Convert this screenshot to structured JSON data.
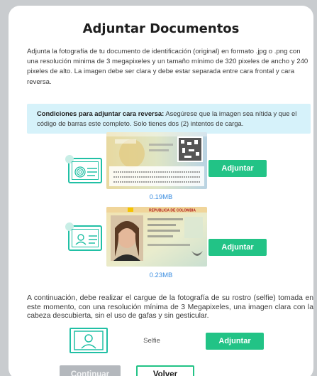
{
  "modal": {
    "title": "Adjuntar Documentos",
    "intro": "Adjunta la fotografía de tu documento de identificación (original) en formato .jpg o .png con una resolución minima de 3 megapixeles y un tamaño mínimo de 320 pixeles de ancho y 240 pixeles de alto. La imagen debe ser clara y debe estar separada entre cara frontal y cara reversa.",
    "notice": {
      "bold": "Condiciones para adjuntar cara reversa:",
      "text": " Asegúrese que la imagen sea nítida y que el código de barras este completo. Solo tienes dos (2) intentos de carga."
    },
    "documents": [
      {
        "id": "reverse",
        "size": "0.19MB",
        "button": "Adjuntar",
        "icon": "fingerprint-card-icon"
      },
      {
        "id": "front",
        "size": "0.23MB",
        "button": "Adjuntar",
        "icon": "id-card-icon",
        "header_text": "REPUBLICA DE COLOMBIA"
      }
    ],
    "selfie": {
      "instructions": "A continuación, debe realizar el cargue de la fotografía de su rostro (selfie) tomada en este momento, con una resolución mínima de 3 Megapixeles, una imagen clara con la cabeza descubierta, sin el uso de gafas y sin gesticular.",
      "label": "Selfie",
      "button": "Adjuntar",
      "icon": "portrait-frame-icon"
    },
    "footer": {
      "continue_label": "Continuar",
      "back_label": "Volver"
    }
  },
  "colors": {
    "accent_green": "#22c386",
    "icon_teal": "#21c0a5",
    "notice_bg": "#d6f2fa",
    "size_blue": "#3c8ee0",
    "disabled_gray": "#b4b8bd"
  }
}
